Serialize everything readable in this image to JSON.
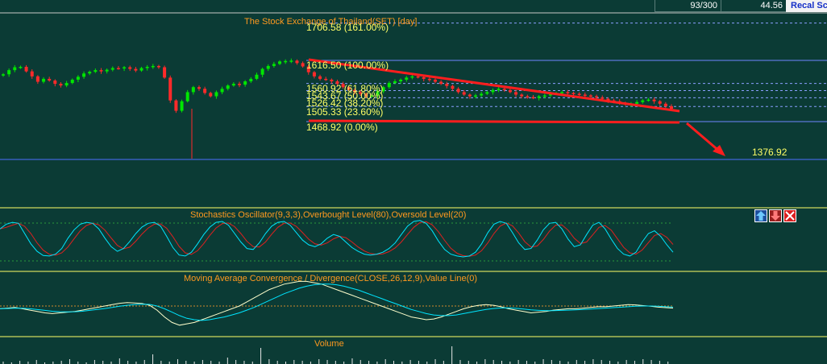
{
  "header": {
    "ratio_text": "93/300",
    "price_text": "44.56",
    "recalc_label": "Recal Sc"
  },
  "price_panel": {
    "title": "The Stock Exchange of Thailand(SET) [day]",
    "fib_labels": [
      "1706.58 (161.00%)",
      "1616.50 (100.00%)",
      "1560.92 (61.80%)",
      "1543.67 (50.00%)",
      "1526.42 (38.20%)",
      "1505.33 (23.60%)",
      "1468.92 (0.00%)"
    ],
    "target_label": "1376.92"
  },
  "stoch_panel": {
    "title": "Stochastics Oscillator(9,3,3),Overbought Level(80),Oversold Level(20)"
  },
  "macd_panel": {
    "title": "Moving Average Convergence / Divergence(CLOSE,26,12,9),Value Line(0)"
  },
  "volume_panel": {
    "title": "Volume"
  },
  "controls": {
    "up_icon": "arrow-up-icon",
    "down_icon": "arrow-down-icon",
    "close_icon": "close-icon"
  },
  "colors": {
    "background": "#0b3b35",
    "candle_up": "#00e600",
    "candle_down": "#ff2a2a",
    "trendline": "#ff1e1e",
    "fib_text": "#ffff66",
    "title_text": "#ff9a1f",
    "stoch_k": "#00e5ff",
    "stoch_d": "#e02020",
    "macd_line": "#ffffcc",
    "signal_line": "#00e5ff"
  },
  "chart_data": {
    "type": "candlestick",
    "ylabel": "",
    "xlabel": "",
    "price_levels": [
      {
        "value": 1706.58,
        "pct": 161.0
      },
      {
        "value": 1616.5,
        "pct": 100.0
      },
      {
        "value": 1560.92,
        "pct": 61.8
      },
      {
        "value": 1543.67,
        "pct": 50.0
      },
      {
        "value": 1526.42,
        "pct": 38.2
      },
      {
        "value": 1505.33,
        "pct": 23.6
      },
      {
        "value": 1468.92,
        "pct": 0.0
      }
    ],
    "target_value": 1376.92,
    "close_values": [
      1583,
      1593,
      1600,
      1601,
      1590,
      1578,
      1565,
      1572,
      1568,
      1560,
      1556,
      1562,
      1570,
      1577,
      1585,
      1589,
      1593,
      1590,
      1594,
      1598,
      1597,
      1600,
      1596,
      1592,
      1598,
      1601,
      1603,
      1600,
      1575,
      1520,
      1495,
      1518,
      1540,
      1552,
      1548,
      1538,
      1530,
      1540,
      1548,
      1556,
      1560,
      1558,
      1566,
      1572,
      1582,
      1596,
      1603,
      1608,
      1614,
      1615,
      1616,
      1610,
      1602,
      1588,
      1578,
      1572,
      1570,
      1566,
      1560,
      1552,
      1545,
      1540,
      1536,
      1530,
      1532,
      1542,
      1552,
      1562,
      1566,
      1570,
      1575,
      1578,
      1576,
      1572,
      1570,
      1565,
      1560,
      1555,
      1548,
      1540,
      1534,
      1530,
      1532,
      1536,
      1540,
      1545,
      1548,
      1545,
      1540,
      1534,
      1530,
      1528,
      1526,
      1530,
      1532,
      1536,
      1538,
      1540,
      1538,
      1536,
      1534,
      1532,
      1530,
      1527,
      1524,
      1520,
      1518,
      1514,
      1510,
      1512,
      1516,
      1520,
      1522,
      1518,
      1512,
      1506,
      1500
    ],
    "stochastic_k": [
      72,
      82,
      86,
      84,
      62,
      40,
      24,
      15,
      14,
      18,
      30,
      52,
      70,
      82,
      86,
      84,
      72,
      52,
      34,
      24,
      30,
      45,
      62,
      76,
      84,
      86,
      78,
      56,
      32,
      16,
      14,
      22,
      40,
      60,
      76,
      86,
      88,
      80,
      62,
      44,
      30,
      28,
      42,
      62,
      78,
      86,
      88,
      80,
      64,
      48,
      38,
      34,
      40,
      52,
      60,
      56,
      44,
      32,
      24,
      18,
      16,
      18,
      22,
      30,
      42,
      60,
      78,
      88,
      90,
      84,
      68,
      46,
      28,
      18,
      14,
      12,
      14,
      22,
      40,
      64,
      82,
      88,
      84,
      64,
      42,
      28,
      30,
      48,
      70,
      84,
      86,
      72,
      50,
      34,
      38,
      60,
      80,
      86,
      72,
      50,
      30,
      18,
      14,
      22,
      44,
      62,
      68,
      56,
      38,
      22
    ],
    "macd_line": [
      -2,
      -1.5,
      -1,
      -2,
      -3,
      -4,
      -5,
      -5.5,
      -5,
      -4.5,
      -4,
      -3,
      -2,
      -1,
      0,
      1,
      2,
      2.5,
      2.2,
      1.8,
      0.5,
      -3,
      -8,
      -12,
      -14,
      -13,
      -12,
      -10,
      -8,
      -6,
      -4,
      -2,
      0,
      3,
      6,
      9,
      12,
      14,
      16,
      17,
      18,
      18,
      17,
      16,
      14,
      12,
      10,
      8,
      6,
      4,
      2,
      0,
      -2,
      -4,
      -6,
      -8,
      -9,
      -10,
      -9.5,
      -8,
      -6,
      -4,
      -2,
      -0.5,
      0.5,
      1,
      0.5,
      -0.5,
      -2,
      -3,
      -4,
      -5,
      -4.5,
      -4,
      -3,
      -2.5,
      -2,
      -2,
      -1.5,
      -1,
      -0.5,
      -0.5,
      0,
      0.5,
      1,
      0.8,
      0.3,
      -0.2,
      -0.8,
      -1.2,
      -1.5
    ],
    "signal_line": [
      -2,
      -1.8,
      -1.5,
      -1.6,
      -2,
      -2.6,
      -3.2,
      -3.8,
      -4.2,
      -4.3,
      -4.2,
      -3.8,
      -3.2,
      -2.5,
      -1.8,
      -1,
      -0.2,
      0.5,
      1,
      1.3,
      1.2,
      0,
      -2,
      -4.5,
      -7,
      -9,
      -10,
      -10.5,
      -10,
      -9,
      -8,
      -6.5,
      -5,
      -3,
      -1,
      1.5,
      4,
      6.5,
      9,
      11,
      13,
      14.5,
      15.5,
      16,
      16,
      15.5,
      14.5,
      13,
      11.5,
      9.5,
      7.5,
      5.5,
      3.5,
      1.5,
      -0.5,
      -2.5,
      -4,
      -5.5,
      -6.5,
      -7,
      -7,
      -6.5,
      -5.5,
      -4.5,
      -3.5,
      -2.5,
      -1.8,
      -1.4,
      -1.4,
      -1.7,
      -2.2,
      -2.8,
      -3.2,
      -3.4,
      -3.4,
      -3.2,
      -3,
      -2.8,
      -2.5,
      -2.2,
      -1.8,
      -1.5,
      -1.2,
      -0.9,
      -0.5,
      -0.2,
      0,
      0,
      -0.2,
      -0.5,
      -0.8
    ],
    "volume": [
      3,
      2,
      4,
      3,
      5,
      2,
      3,
      4,
      6,
      3,
      2,
      5,
      4,
      3,
      7,
      4,
      3,
      5,
      12,
      4,
      3,
      6,
      4,
      3,
      5,
      4,
      3,
      8,
      5,
      4,
      3,
      20,
      6,
      4,
      3,
      5,
      4,
      3,
      6,
      5,
      4,
      3,
      7,
      5,
      4,
      3,
      6,
      4,
      3,
      5,
      4,
      3,
      6,
      4,
      22,
      5,
      4,
      3,
      6,
      5,
      4,
      3,
      5,
      4,
      3,
      6,
      5,
      4,
      3,
      5,
      4,
      6,
      5,
      4,
      3,
      5,
      4,
      6,
      5,
      4,
      3
    ]
  }
}
